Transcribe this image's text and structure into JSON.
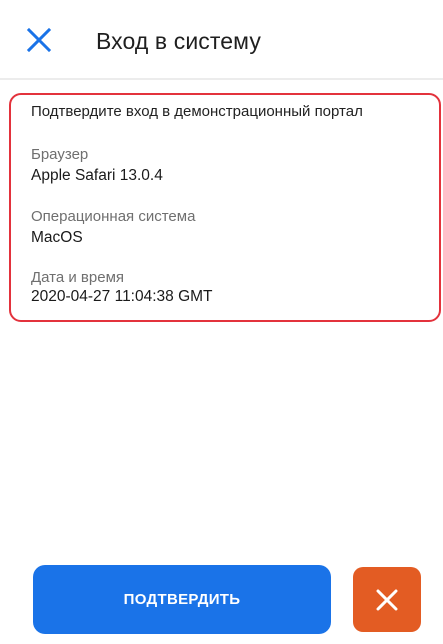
{
  "header": {
    "title": "Вход в систему"
  },
  "details": {
    "heading": "Подтвердите вход в демонстрационный портал",
    "browser_label": "Браузер",
    "browser_value": "Apple Safari 13.0.4",
    "os_label": "Операционная система",
    "os_value": "MacOS",
    "datetime_label": "Дата и время",
    "datetime_value": "2020-04-27 11:04:38 GMT"
  },
  "actions": {
    "confirm_label": "ПОДТВЕРДИТЬ",
    "reject_icon": "close-icon"
  },
  "colors": {
    "accent_blue": "#1a73e8",
    "highlight_red": "#e3323c",
    "reject_orange": "#e35c23"
  }
}
